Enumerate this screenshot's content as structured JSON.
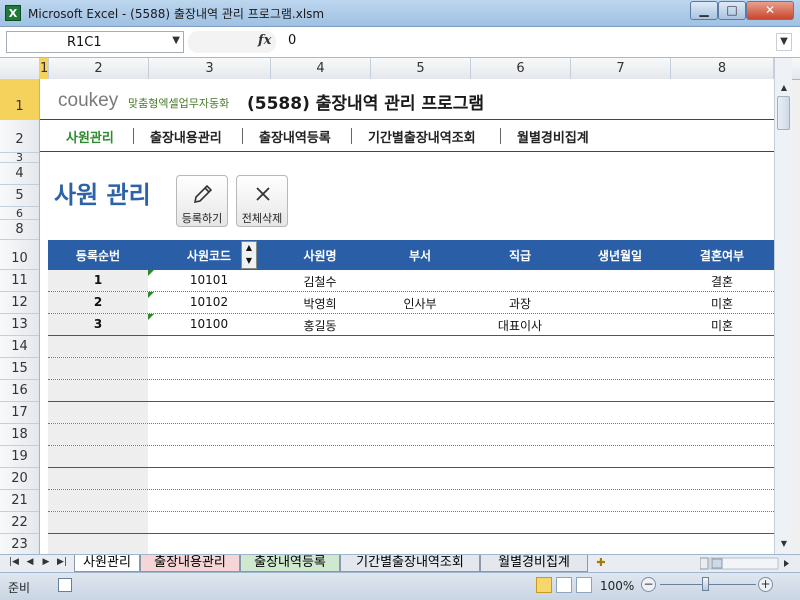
{
  "window": {
    "app_icon": "X",
    "title": "Microsoft Excel - (5588) 출장내역 관리 프로그램.xlsm",
    "min_label": "▁",
    "max_label": "□",
    "close_label": "✕"
  },
  "formula_bar": {
    "name_box": "R1C1",
    "fx_label": "fx",
    "value": "0"
  },
  "columns": [
    "1",
    "2",
    "3",
    "4",
    "5",
    "6",
    "7",
    "8"
  ],
  "rows": [
    "1",
    "2",
    "3",
    "4",
    "5",
    "6",
    "8",
    "10",
    "11",
    "12",
    "13",
    "14",
    "15",
    "16",
    "17",
    "18",
    "19",
    "20",
    "21",
    "22",
    "23"
  ],
  "sheet": {
    "brand": "coukey",
    "brand_sub": "맞춤형엑셀업무자동화",
    "title": "(5588) 출장내역 관리 프로그램",
    "nav": [
      "사원관리",
      "출장내용관리",
      "출장내역등록",
      "기간별출장내역조회",
      "월별경비집계"
    ],
    "nav_sep": "|",
    "heading": "사원 관리",
    "buttons": {
      "register": "등록하기",
      "delete_all": "전체삭제"
    },
    "headers": [
      "등록순번",
      "사원코드",
      "사원명",
      "부서",
      "직급",
      "생년월일",
      "결혼여부"
    ],
    "records": [
      {
        "no": "1",
        "code": "10101",
        "name": "김철수",
        "dept": "",
        "rank": "",
        "birth": "",
        "married": "결혼"
      },
      {
        "no": "2",
        "code": "10102",
        "name": "박영희",
        "dept": "인사부",
        "rank": "과장",
        "birth": "",
        "married": "미혼"
      },
      {
        "no": "3",
        "code": "10100",
        "name": "홍길동",
        "dept": "",
        "rank": "대표이사",
        "birth": "",
        "married": "미혼"
      }
    ]
  },
  "tabs": [
    "사원관리",
    "출장내용관리",
    "출장내역등록",
    "기간별출장내역조회",
    "월별경비집계"
  ],
  "status": {
    "ready": "준비",
    "zoom": "100%",
    "zoom_minus": "−",
    "zoom_plus": "+"
  },
  "icons": {
    "pencil": "pencil-icon",
    "close": "close-icon"
  },
  "colors": {
    "header_blue": "#2a5fa8",
    "heading_blue": "#2c63a8",
    "nav_active": "#2e8b2e",
    "brand_green": "#6b9a2c"
  }
}
